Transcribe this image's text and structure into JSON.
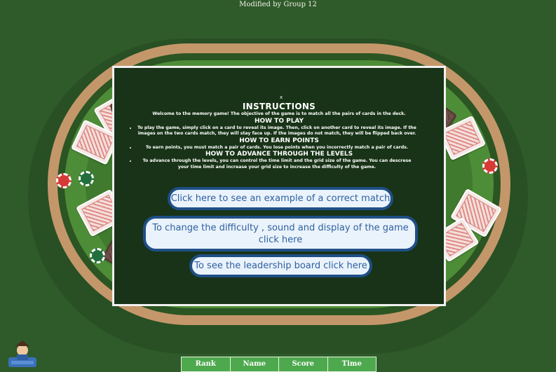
{
  "credit": "Modified by Group 12",
  "instructions": {
    "close": "x",
    "title": "INSTRUCTIONS",
    "intro": "Welcome to the memory game! The objective of the game is to match all the pairs of cards in the deck.",
    "how_to_play_heading": "HOW TO PLAY",
    "how_to_play": "To play the game, simply click on a card to reveal its image. Then, click on another card to reveal its image. If the images on the two cards match, they will stay face up. If the images do not match, they will be flipped back over.",
    "points_heading": "HOW TO EARN POINTS",
    "points": "To earn points, you must match a pair of cards. You lose points when you incorrectly match a pair of cards.",
    "levels_heading": "HOW TO ADVANCE THROUGH THE LEVELS",
    "levels": "To advance through the levels, you can control the time limit and the grid size of the game. You can descrese your time limit and increase your grid size to increase the difficulty of the game."
  },
  "buttons": {
    "example": "Click here to see an example of a correct match",
    "settings": "To change the difficulty , sound and display of the game click here",
    "leaderboard": "To see the leadership board click here"
  },
  "leaderboard": {
    "columns": [
      "Rank",
      "Name",
      "Score",
      "Time"
    ]
  },
  "icons": {
    "avatar": "user-avatar-icon"
  },
  "colors": {
    "background": "#2f5a2a",
    "felt": "#4e8d37",
    "rim": "#c4976a",
    "button_border": "#1f4f86",
    "button_text": "#2e5fa0",
    "leaderboard_header": "#4ea94e"
  }
}
